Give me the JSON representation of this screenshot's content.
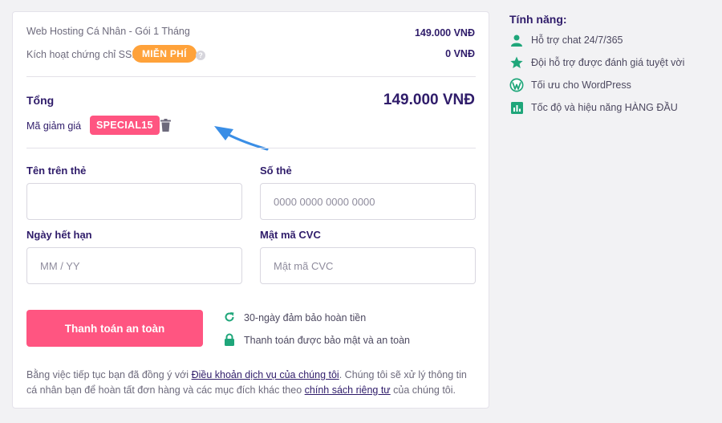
{
  "order": {
    "item_label": "Web Hosting Cá Nhân - Gói 1 Tháng",
    "item_price": "149.000 VNĐ",
    "ssl_label": "Kích hoạt chứng chỉ SSL",
    "ssl_badge": "MIỄN PHÍ",
    "ssl_price": "0 VNĐ",
    "total_label": "Tổng",
    "total_price": "149.000 VNĐ",
    "coupon_label": "Mã giảm giá",
    "coupon_code": "SPECIAL15"
  },
  "form": {
    "name_label": "Tên trên thẻ",
    "name_value": "",
    "card_label": "Số thẻ",
    "card_placeholder": "0000 0000 0000 0000",
    "expiry_label": "Ngày hết hạn",
    "expiry_placeholder": "MM / YY",
    "cvc_label": "Mật mã CVC",
    "cvc_placeholder": "Mật mã CVC"
  },
  "payment": {
    "button_label": "Thanh toán an toàn",
    "guarantee_refund": "30-ngày đảm bảo hoàn tiền",
    "guarantee_secure": "Thanh toán được bảo mật và an toàn"
  },
  "legal": {
    "part1": "Bằng việc tiếp tục bạn đã đồng ý với ",
    "terms_link": "Điều khoản dịch vụ của chúng tôi",
    "part2": ". Chúng tôi sẽ xử lý thông tin cá nhân bạn để hoàn tất đơn hàng và các mục đích khác theo ",
    "privacy_link": "chính sách riêng tư",
    "part3": " của chúng tôi."
  },
  "features": {
    "title": "Tính năng:",
    "items": [
      {
        "icon": "user-icon",
        "label": "Hỗ trợ chat 24/7/365"
      },
      {
        "icon": "star-icon",
        "label": "Đội hỗ trợ được đánh giá tuyệt vời"
      },
      {
        "icon": "wordpress-icon",
        "label": "Tối ưu cho WordPress"
      },
      {
        "icon": "bar-chart-icon",
        "label": "Tốc độ và hiệu năng HÀNG ĐẦU"
      }
    ]
  },
  "colors": {
    "accent_pink": "#ff5581",
    "badge_orange": "#ffa23a",
    "icon_green": "#1fa67a",
    "annotation_arrow": "#3a8ee6",
    "text_dark": "#2f1c6a"
  }
}
